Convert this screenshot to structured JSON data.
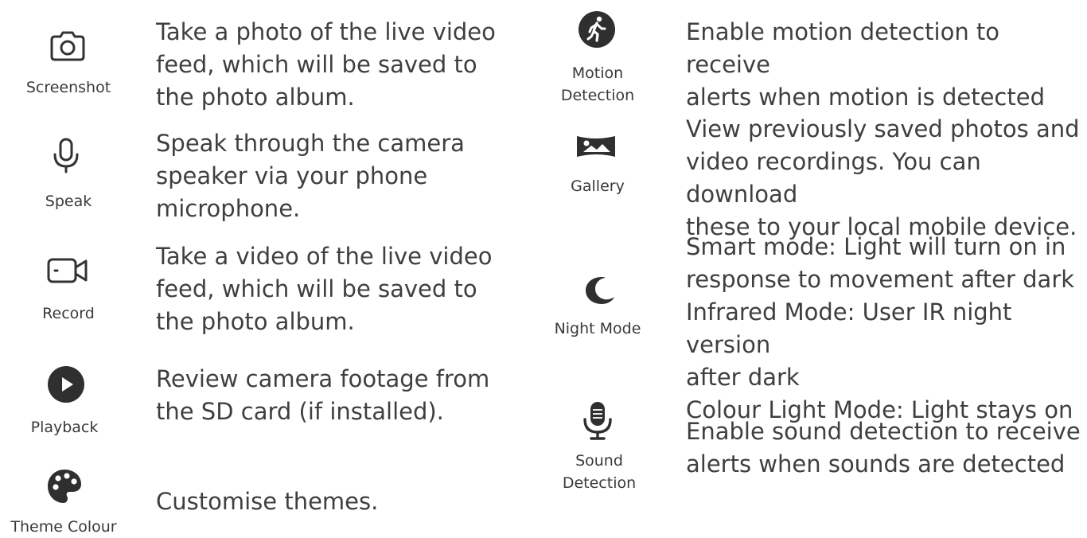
{
  "left_column": [
    {
      "icon": "camera-icon",
      "label": "Screenshot",
      "description": "Take a photo of the live video\nfeed, which will be saved to\nthe photo album."
    },
    {
      "icon": "microphone-icon",
      "label": "Speak",
      "description": "Speak through the camera\nspeaker via your phone\nmicrophone."
    },
    {
      "icon": "video-camera-icon",
      "label": "Record",
      "description": "Take a video of the live video\nfeed, which will be saved to\nthe photo album."
    },
    {
      "icon": "play-icon",
      "label": "Playback",
      "description": "Review camera footage from\nthe SD card (if installed)."
    },
    {
      "icon": "palette-icon",
      "label": "Theme Colour",
      "description": "Customise themes."
    }
  ],
  "right_column": [
    {
      "icon": "running-person-icon",
      "label": "Motion\nDetection",
      "description": "Enable motion detection to receive\nalerts when motion is detected"
    },
    {
      "icon": "gallery-icon",
      "label": "Gallery",
      "description": "View previously saved photos and\nvideo recordings. You can download\nthese to your local mobile device."
    },
    {
      "icon": "moon-icon",
      "label": "Night Mode",
      "description": "Smart mode: Light will turn on in\nresponse to movement after dark\nInfrared Mode: User IR night version\nafter dark\nColour Light Mode: Light stays on"
    },
    {
      "icon": "sound-microphone-icon",
      "label": "Sound\nDetection",
      "description": "Enable sound detection to receive\nalerts when sounds are detected"
    }
  ]
}
